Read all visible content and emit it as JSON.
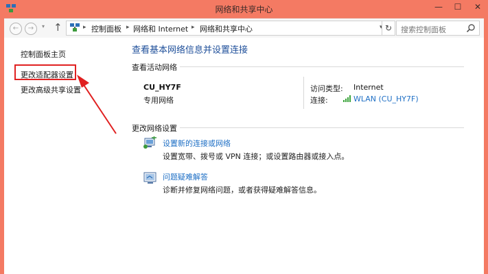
{
  "window": {
    "title": "网络和共享中心",
    "min_glyph": "—",
    "max_glyph": "☐",
    "close_glyph": "✕"
  },
  "nav": {
    "back_glyph": "←",
    "forward_glyph": "→",
    "dropdown_glyph": "▾",
    "up_glyph": "↑",
    "breadcrumb": [
      "控制面板",
      "网络和 Internet",
      "网络和共享中心"
    ],
    "crumb_sep_glyph": "▸",
    "addr_drop_glyph": "▾",
    "refresh_glyph": "↻",
    "search_placeholder": "搜索控制面板"
  },
  "sidebar": {
    "home": "控制面板主页",
    "adapter": "更改适配器设置",
    "advanced": "更改高级共享设置"
  },
  "main": {
    "title": "查看基本网络信息并设置连接",
    "active_section": "查看活动网络",
    "network": {
      "name": "CU_HY7F",
      "category": "专用网络",
      "access_label": "访问类型:",
      "access_value": "Internet",
      "connection_label": "连接:",
      "connection_value": "WLAN (CU_HY7F)"
    },
    "change_section": "更改网络设置",
    "tasks": [
      {
        "link": "设置新的连接或网络",
        "desc": "设置宽带、拨号或 VPN 连接；或设置路由器或接入点。",
        "icon": "new-connection-icon"
      },
      {
        "link": "问题疑难解答",
        "desc": "诊断并修复网络问题，或者获得疑难解答信息。",
        "icon": "troubleshoot-icon"
      }
    ]
  },
  "colors": {
    "window_frame": "#f47a63",
    "link_blue": "#1e6fc5",
    "title_blue": "#1e4f9a",
    "highlight_red": "#e02020"
  }
}
